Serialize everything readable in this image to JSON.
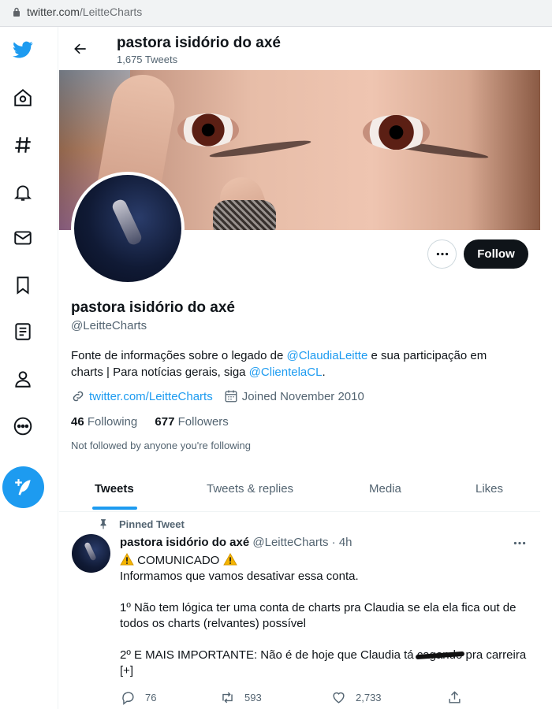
{
  "browser": {
    "url_host": "twitter.com",
    "url_path": "/LeitteCharts"
  },
  "header": {
    "name": "pastora isidório do axé",
    "tweet_count": "1,675 Tweets"
  },
  "profile": {
    "name": "pastora isidório do axé",
    "handle": "@LeitteCharts",
    "bio_part1": "Fonte de informações sobre o legado de ",
    "bio_mention1": "@ClaudiaLeitte",
    "bio_part2": " e sua participação em charts | Para notícias gerais, siga ",
    "bio_mention2": "@ClientelaCL",
    "bio_part3": ".",
    "website": "twitter.com/LeitteCharts",
    "joined": "Joined November 2010",
    "following_count": "46",
    "following_label": "Following",
    "followers_count": "677",
    "followers_label": "Followers",
    "followed_note": "Not followed by anyone you're following",
    "follow_button": "Follow"
  },
  "tabs": [
    {
      "label": "Tweets",
      "active": true
    },
    {
      "label": "Tweets & replies",
      "active": false
    },
    {
      "label": "Media",
      "active": false
    },
    {
      "label": "Likes",
      "active": false
    }
  ],
  "pinned_tweet": {
    "pinned_label": "Pinned Tweet",
    "author_name": "pastora isidório do axé",
    "author_handle": "@LeitteCharts",
    "separator": "·",
    "time": "4h",
    "line1": "COMUNICADO",
    "line2": "Informamos que vamos desativar essa conta.",
    "line3": "1º Não tem lógica ter uma conta de charts pra Claudia se ela ela fica out de todos os charts (relvantes) possível",
    "line4_a": "2º E MAIS IMPORTANTE: Não é de hoje que Claudia tá ",
    "line4_struck": "cagando",
    "line4_b": " pra carreira",
    "line5": "[+]",
    "replies": "76",
    "retweets": "593",
    "likes": "2,733"
  },
  "colors": {
    "accent": "#1d9bf0",
    "text": "#0f1419",
    "muted": "#536471",
    "follow_bg": "#0f1419"
  },
  "icons": [
    "twitter-logo-icon",
    "home-icon",
    "explore-hashtag-icon",
    "notifications-bell-icon",
    "messages-envelope-icon",
    "bookmarks-icon",
    "lists-icon",
    "profile-icon",
    "more-circle-icon",
    "compose-tweet-icon",
    "back-arrow-icon",
    "more-dots-icon",
    "link-icon",
    "calendar-icon",
    "pin-icon",
    "warning-icon",
    "reply-icon",
    "retweet-icon",
    "like-heart-icon",
    "share-icon"
  ]
}
